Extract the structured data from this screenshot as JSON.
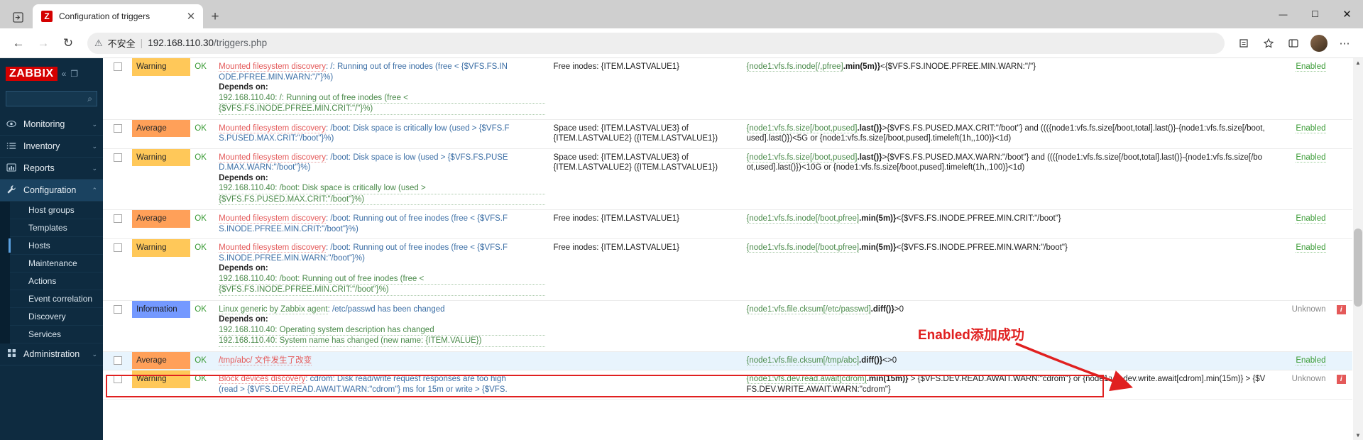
{
  "browser": {
    "tab": {
      "title": "Configuration of triggers",
      "favicon_text": "Z",
      "close_icon": "✕"
    },
    "new_tab_icon": "+",
    "tab_list_icon": "⬒",
    "window": {
      "minimize": "—",
      "maximize": "☐",
      "close": "✕"
    },
    "nav": {
      "back": "←",
      "forward": "→",
      "reload": "↻"
    },
    "omnibox": {
      "warning_icon": "⚠",
      "security_label": "不安全",
      "separator": "|",
      "url_host": "192.168.110.30",
      "url_path": "/triggers.php"
    },
    "toolbar_icons": {
      "collections": "☆",
      "favorites": "⭐",
      "browser_essentials": "⊞",
      "settings": "⋯"
    }
  },
  "sidebar": {
    "logo": "ZABBIX",
    "collapse_icon": "«",
    "compact_icon": "❐",
    "search_icon": "⌕",
    "items": [
      {
        "label": "Monitoring",
        "icon": "◉",
        "chevron": "⌄"
      },
      {
        "label": "Inventory",
        "icon": "☰",
        "chevron": "⌄"
      },
      {
        "label": "Reports",
        "icon": "Ὄa",
        "chevron": "⌄"
      },
      {
        "label": "Configuration",
        "icon": "🔧",
        "chevron": "⌃"
      }
    ],
    "submenu": [
      "Host groups",
      "Templates",
      "Hosts",
      "Maintenance",
      "Actions",
      "Event correlation",
      "Discovery",
      "Services"
    ],
    "selected_submenu": "Hosts",
    "administration": {
      "label": "Administration",
      "icon": "⊞",
      "chevron": "⌄"
    }
  },
  "annotation": {
    "text": "Enabled添加成功",
    "color": "#e02020"
  },
  "table": {
    "rows": [
      {
        "severity": "Warning",
        "sev_class": "sev-warning",
        "status": "OK",
        "name_prefix": "Mounted filesystem discovery",
        "name_main": ": /: Running out of free inodes (free < {$VFS.FS.IN",
        "name_cont": "ODE.PFREE.MIN.WARN:\"/\"}%)",
        "depends_label": "Depends on:",
        "depends": [
          "192.168.110.40: /: Running out of free inodes (free <",
          "{$VFS.FS.INODE.PFREE.MIN.CRIT:\"/\"}%)"
        ],
        "value": "Free inodes: {ITEM.LASTVALUE1}",
        "expr_item": "{node1:vfs.fs.inode[/,pfree]",
        "expr_fn": ".min(5m)}",
        "expr_tail": "<{$VFS.FS.INODE.PFREE.MIN.WARN:\"/\"}",
        "state": "Enabled",
        "state_class": "state-enabled",
        "info": ""
      },
      {
        "severity": "Average",
        "sev_class": "sev-average",
        "status": "OK",
        "name_prefix": "Mounted filesystem discovery",
        "name_main": ": /boot: Disk space is critically low (used > {$VFS.F",
        "name_cont": "S.PUSED.MAX.CRIT:\"/boot\"}%)",
        "depends_label": "",
        "depends": [],
        "value": "Space used: {ITEM.LASTVALUE3} of {ITEM.LASTVALUE2} ({ITEM.LASTVALUE1})",
        "expr_item": "{node1:vfs.fs.size[/boot,pused]",
        "expr_fn": ".last()}",
        "expr_tail": ">{$VFS.FS.PUSED.MAX.CRIT:\"/boot\"} and ((({node1:vfs.fs.size[/boot,total].last()}-{node1:vfs.fs.size[/boot,used].last()})<5G or {node1:vfs.fs.size[/boot,pused].timeleft(1h,,100)}<1d)",
        "state": "Enabled",
        "state_class": "state-enabled",
        "info": ""
      },
      {
        "severity": "Warning",
        "sev_class": "sev-warning",
        "status": "OK",
        "name_prefix": "Mounted filesystem discovery",
        "name_main": ": /boot: Disk space is low (used > {$VFS.FS.PUSE",
        "name_cont": "D.MAX.WARN:\"/boot\"}%)",
        "depends_label": "Depends on:",
        "depends": [
          "192.168.110.40: /boot: Disk space is critically low (used >",
          "{$VFS.FS.PUSED.MAX.CRIT:\"/boot\"}%)"
        ],
        "value": "Space used: {ITEM.LASTVALUE3} of {ITEM.LASTVALUE2} ({ITEM.LASTVALUE1})",
        "expr_item": "{node1:vfs.fs.size[/boot,pused]",
        "expr_fn": ".last()}",
        "expr_tail": ">{$VFS.FS.PUSED.MAX.WARN:\"/boot\"} and ((({node1:vfs.fs.size[/boot,total].last()}-{node1:vfs.fs.size[/boot,used].last()})<10G or {node1:vfs.fs.size[/boot,pused].timeleft(1h,,100)}<1d)",
        "state": "Enabled",
        "state_class": "state-enabled",
        "info": ""
      },
      {
        "severity": "Average",
        "sev_class": "sev-average",
        "status": "OK",
        "name_prefix": "Mounted filesystem discovery",
        "name_main": ": /boot: Running out of free inodes (free < {$VFS.F",
        "name_cont": "S.INODE.PFREE.MIN.CRIT:\"/boot\"}%)",
        "depends_label": "",
        "depends": [],
        "value": "Free inodes: {ITEM.LASTVALUE1}",
        "expr_item": "{node1:vfs.fs.inode[/boot,pfree]",
        "expr_fn": ".min(5m)}",
        "expr_tail": "<{$VFS.FS.INODE.PFREE.MIN.CRIT:\"/boot\"}",
        "state": "Enabled",
        "state_class": "state-enabled",
        "info": ""
      },
      {
        "severity": "Warning",
        "sev_class": "sev-warning",
        "status": "OK",
        "name_prefix": "Mounted filesystem discovery",
        "name_main": ": /boot: Running out of free inodes (free < {$VFS.F",
        "name_cont": "S.INODE.PFREE.MIN.WARN:\"/boot\"}%)",
        "depends_label": "Depends on:",
        "depends": [
          "192.168.110.40: /boot: Running out of free inodes (free <",
          "{$VFS.FS.INODE.PFREE.MIN.CRIT:\"/boot\"}%)"
        ],
        "value": "Free inodes: {ITEM.LASTVALUE1}",
        "expr_item": "{node1:vfs.fs.inode[/boot,pfree]",
        "expr_fn": ".min(5m)}",
        "expr_tail": "<{$VFS.FS.INODE.PFREE.MIN.WARN:\"/boot\"}",
        "state": "Enabled",
        "state_class": "state-enabled",
        "info": ""
      },
      {
        "severity": "Information",
        "sev_class": "sev-information",
        "status": "OK",
        "name_prefix": "Linux generic by Zabbix agent",
        "name_main": ": /etc/passwd has been changed",
        "name_cont": "",
        "depends_label": "Depends on:",
        "depends": [
          "192.168.110.40: Operating system description has changed",
          "192.168.110.40: System name has changed (new name: {ITEM.VALUE})"
        ],
        "value": "",
        "expr_item": "{node1:vfs.file.cksum[/etc/passwd]",
        "expr_fn": ".diff()}",
        "expr_tail": ">0",
        "state": "Unknown",
        "state_class": "state-unknown",
        "info": "i"
      },
      {
        "severity": "Average",
        "sev_class": "sev-average",
        "status": "OK",
        "name_prefix": "",
        "name_main": "/tmp/abc/ 文件发生了改变",
        "name_cont": "",
        "depends_label": "",
        "depends": [],
        "value": "",
        "expr_item": "{node1:vfs.file.cksum[/tmp/abc]",
        "expr_fn": ".diff()}",
        "expr_tail": "<>0",
        "state": "Enabled",
        "state_class": "state-enabled",
        "info": "",
        "highlight": true
      },
      {
        "severity": "Warning",
        "sev_class": "sev-warning",
        "status": "OK",
        "name_prefix": "Block devices discovery",
        "name_main": ": cdrom: Disk read/write request responses are too high",
        "name_cont": "(read > {$VFS.DEV.READ.AWAIT.WARN:\"cdrom\"} ms for 15m or write > {$VFS.",
        "depends_label": "",
        "depends": [],
        "value": "",
        "expr_item": "{node1:vfs.dev.read.await[cdrom]",
        "expr_fn": ".min(15m)}",
        "expr_tail": " > {$VFS.DEV.READ.AWAIT.WARN:\"cdrom\"} or {node1:vfs.dev.write.await[cdrom].min(15m)} > {$VFS.DEV.WRITE.AWAIT.WARN:\"cdrom\"}",
        "state": "Unknown",
        "state_class": "state-unknown",
        "info": "i"
      }
    ]
  }
}
